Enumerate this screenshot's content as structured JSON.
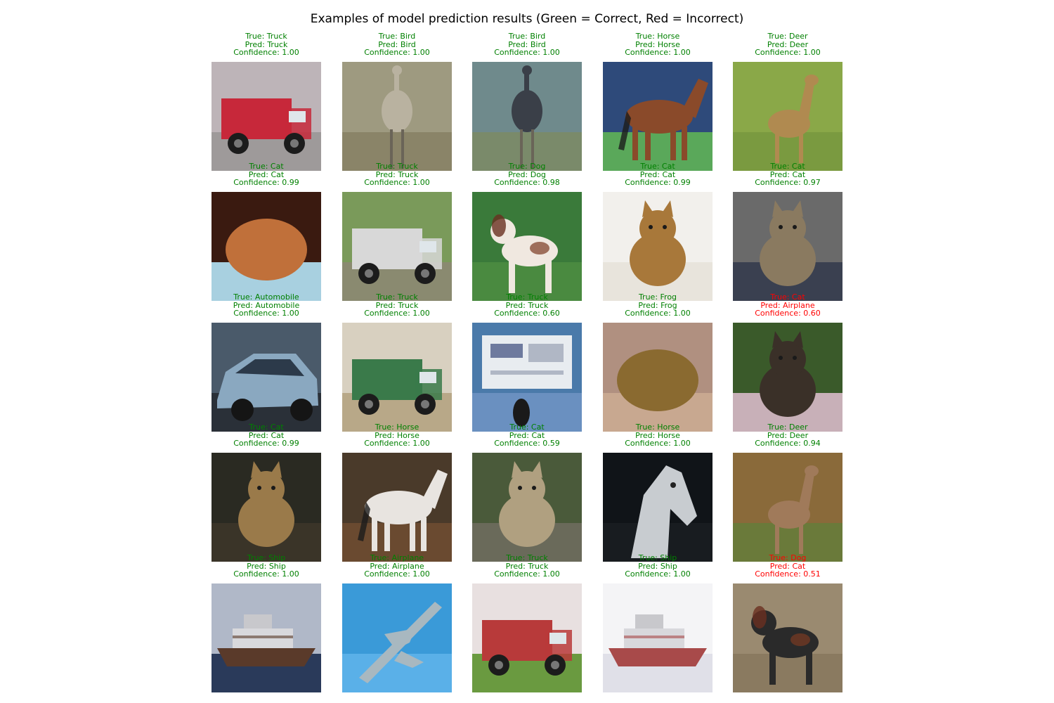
{
  "title": "Examples of model prediction results (Green = Correct, Red = Incorrect)",
  "colors": {
    "correct": "#008000",
    "incorrect": "#ff0000"
  },
  "samples": [
    {
      "true_line": "True: Truck",
      "pred_line": "Pred: Truck",
      "conf_line": "Confidence: 1.00",
      "correct": true,
      "subject": "red-fire-truck",
      "scene": {
        "bg": "#bdb4b8",
        "ground": "#9e9a9a",
        "subject_color": "#c7283a",
        "shape": "truck"
      }
    },
    {
      "true_line": "True: Bird",
      "pred_line": "Pred: Bird",
      "conf_line": "Confidence: 1.00",
      "correct": true,
      "subject": "ostrich-closeup",
      "scene": {
        "bg": "#9e9a80",
        "ground": "#8a8468",
        "subject_color": "#b9b2a0",
        "shape": "bird"
      }
    },
    {
      "true_line": "True: Bird",
      "pred_line": "Pred: Bird",
      "conf_line": "Confidence: 1.00",
      "correct": true,
      "subject": "ostrich-standing",
      "scene": {
        "bg": "#6f8a8c",
        "ground": "#7a8a6a",
        "subject_color": "#3a3f48",
        "shape": "bird"
      }
    },
    {
      "true_line": "True: Horse",
      "pred_line": "Pred: Horse",
      "conf_line": "Confidence: 1.00",
      "correct": true,
      "subject": "brown-horse",
      "scene": {
        "bg": "#2e4a7a",
        "ground": "#5aa85a",
        "subject_color": "#8a4a2a",
        "shape": "horse"
      }
    },
    {
      "true_line": "True: Deer",
      "pred_line": "Pred: Deer",
      "conf_line": "Confidence: 1.00",
      "correct": true,
      "subject": "deer-in-grass",
      "scene": {
        "bg": "#8aa848",
        "ground": "#7a9a40",
        "subject_color": "#b08a50",
        "shape": "deer"
      }
    },
    {
      "true_line": "True: Cat",
      "pred_line": "Pred: Cat",
      "conf_line": "Confidence: 0.99",
      "correct": true,
      "subject": "sleeping-orange-cat",
      "scene": {
        "bg": "#3a1a10",
        "ground": "#a8d0e0",
        "subject_color": "#c0703a",
        "shape": "blob"
      }
    },
    {
      "true_line": "True: Truck",
      "pred_line": "Pred: Truck",
      "conf_line": "Confidence: 1.00",
      "correct": true,
      "subject": "dump-truck",
      "scene": {
        "bg": "#7a9a5a",
        "ground": "#8a8a70",
        "subject_color": "#d8d8d8",
        "shape": "truck"
      }
    },
    {
      "true_line": "True: Dog",
      "pred_line": "Pred: Dog",
      "conf_line": "Confidence: 0.98",
      "correct": true,
      "subject": "spotted-dog",
      "scene": {
        "bg": "#3a7a3a",
        "ground": "#4a8a40",
        "subject_color": "#f0e8e0",
        "shape": "dog"
      }
    },
    {
      "true_line": "True: Cat",
      "pred_line": "Pred: Cat",
      "conf_line": "Confidence: 0.99",
      "correct": true,
      "subject": "tabby-cat",
      "scene": {
        "bg": "#f2f0ec",
        "ground": "#e8e4dc",
        "subject_color": "#a8783a",
        "shape": "cat"
      }
    },
    {
      "true_line": "True: Cat",
      "pred_line": "Pred: Cat",
      "conf_line": "Confidence: 0.97",
      "correct": true,
      "subject": "cat-indoors",
      "scene": {
        "bg": "#6a6a6a",
        "ground": "#3a4050",
        "subject_color": "#8a7a60",
        "shape": "cat"
      }
    },
    {
      "true_line": "True: Automobile",
      "pred_line": "Pred: Automobile",
      "conf_line": "Confidence: 1.00",
      "correct": true,
      "subject": "blue-car",
      "scene": {
        "bg": "#4a5a6a",
        "ground": "#2a3038",
        "subject_color": "#8aa8c0",
        "shape": "car"
      }
    },
    {
      "true_line": "True: Truck",
      "pred_line": "Pred: Truck",
      "conf_line": "Confidence: 1.00",
      "correct": true,
      "subject": "green-garbage-truck",
      "scene": {
        "bg": "#d8d0c0",
        "ground": "#b8a888",
        "subject_color": "#3a7a4a",
        "shape": "truck"
      }
    },
    {
      "true_line": "True: Truck",
      "pred_line": "Pred: Truck",
      "conf_line": "Confidence: 0.60",
      "correct": true,
      "subject": "billboard-truck",
      "scene": {
        "bg": "#4a7aaa",
        "ground": "#6a90c0",
        "subject_color": "#e8ecf0",
        "shape": "sign"
      }
    },
    {
      "true_line": "True: Frog",
      "pred_line": "Pred: Frog",
      "conf_line": "Confidence: 1.00",
      "correct": true,
      "subject": "frog-in-hand",
      "scene": {
        "bg": "#b09080",
        "ground": "#c8a890",
        "subject_color": "#8a6a30",
        "shape": "blob"
      }
    },
    {
      "true_line": "True: Cat",
      "pred_line": "Pred: Airplane",
      "conf_line": "Confidence: 0.60",
      "correct": false,
      "subject": "cat-on-car",
      "scene": {
        "bg": "#3a5a2a",
        "ground": "#c8b0b8",
        "subject_color": "#3a3028",
        "shape": "cat"
      }
    },
    {
      "true_line": "True: Cat",
      "pred_line": "Pred: Cat",
      "conf_line": "Confidence: 0.99",
      "correct": true,
      "subject": "cat-with-sign",
      "scene": {
        "bg": "#2a2a22",
        "ground": "#3a3428",
        "subject_color": "#9a7a4a",
        "shape": "cat"
      }
    },
    {
      "true_line": "True: Horse",
      "pred_line": "Pred: Horse",
      "conf_line": "Confidence: 1.00",
      "correct": true,
      "subject": "white-horse-rider",
      "scene": {
        "bg": "#4a3a2a",
        "ground": "#6a4a30",
        "subject_color": "#e8e4e0",
        "shape": "horse"
      }
    },
    {
      "true_line": "True: Cat",
      "pred_line": "Pred: Cat",
      "conf_line": "Confidence: 0.59",
      "correct": true,
      "subject": "cat-outdoors",
      "scene": {
        "bg": "#4a5a3a",
        "ground": "#6a6a5a",
        "subject_color": "#b0a080",
        "shape": "cat"
      }
    },
    {
      "true_line": "True: Horse",
      "pred_line": "Pred: Horse",
      "conf_line": "Confidence: 1.00",
      "correct": true,
      "subject": "white-horse-head",
      "scene": {
        "bg": "#101418",
        "ground": "#181c20",
        "subject_color": "#c8ccd0",
        "shape": "horsehead"
      }
    },
    {
      "true_line": "True: Deer",
      "pred_line": "Pred: Deer",
      "conf_line": "Confidence: 0.94",
      "correct": true,
      "subject": "deer-face",
      "scene": {
        "bg": "#8a6a3a",
        "ground": "#6a7a3a",
        "subject_color": "#a07a5a",
        "shape": "deer"
      }
    },
    {
      "true_line": "True: Ship",
      "pred_line": "Pred: Ship",
      "conf_line": "Confidence: 1.00",
      "correct": true,
      "subject": "cargo-ship",
      "scene": {
        "bg": "#b0b8c8",
        "ground": "#2a3a5a",
        "subject_color": "#5a3a2a",
        "shape": "ship"
      }
    },
    {
      "true_line": "True: Airplane",
      "pred_line": "Pred: Airplane",
      "conf_line": "Confidence: 1.00",
      "correct": true,
      "subject": "airplane-in-sky",
      "scene": {
        "bg": "#3a9ad8",
        "ground": "#5ab0e8",
        "subject_color": "#a8b8c0",
        "shape": "plane"
      }
    },
    {
      "true_line": "True: Truck",
      "pred_line": "Pred: Truck",
      "conf_line": "Confidence: 1.00",
      "correct": true,
      "subject": "red-lorry",
      "scene": {
        "bg": "#e8e0e0",
        "ground": "#6a9a40",
        "subject_color": "#b83a3a",
        "shape": "truck"
      }
    },
    {
      "true_line": "True: Ship",
      "pred_line": "Pred: Ship",
      "conf_line": "Confidence: 1.00",
      "correct": true,
      "subject": "striped-ship",
      "scene": {
        "bg": "#f4f4f6",
        "ground": "#e0e0e8",
        "subject_color": "#a84a4a",
        "shape": "ship"
      }
    },
    {
      "true_line": "True: Dog",
      "pred_line": "Pred: Cat",
      "conf_line": "Confidence: 0.51",
      "correct": false,
      "subject": "black-dog-on-ground",
      "scene": {
        "bg": "#9a8a70",
        "ground": "#8a7a60",
        "subject_color": "#2a2a2a",
        "shape": "dog"
      }
    }
  ]
}
